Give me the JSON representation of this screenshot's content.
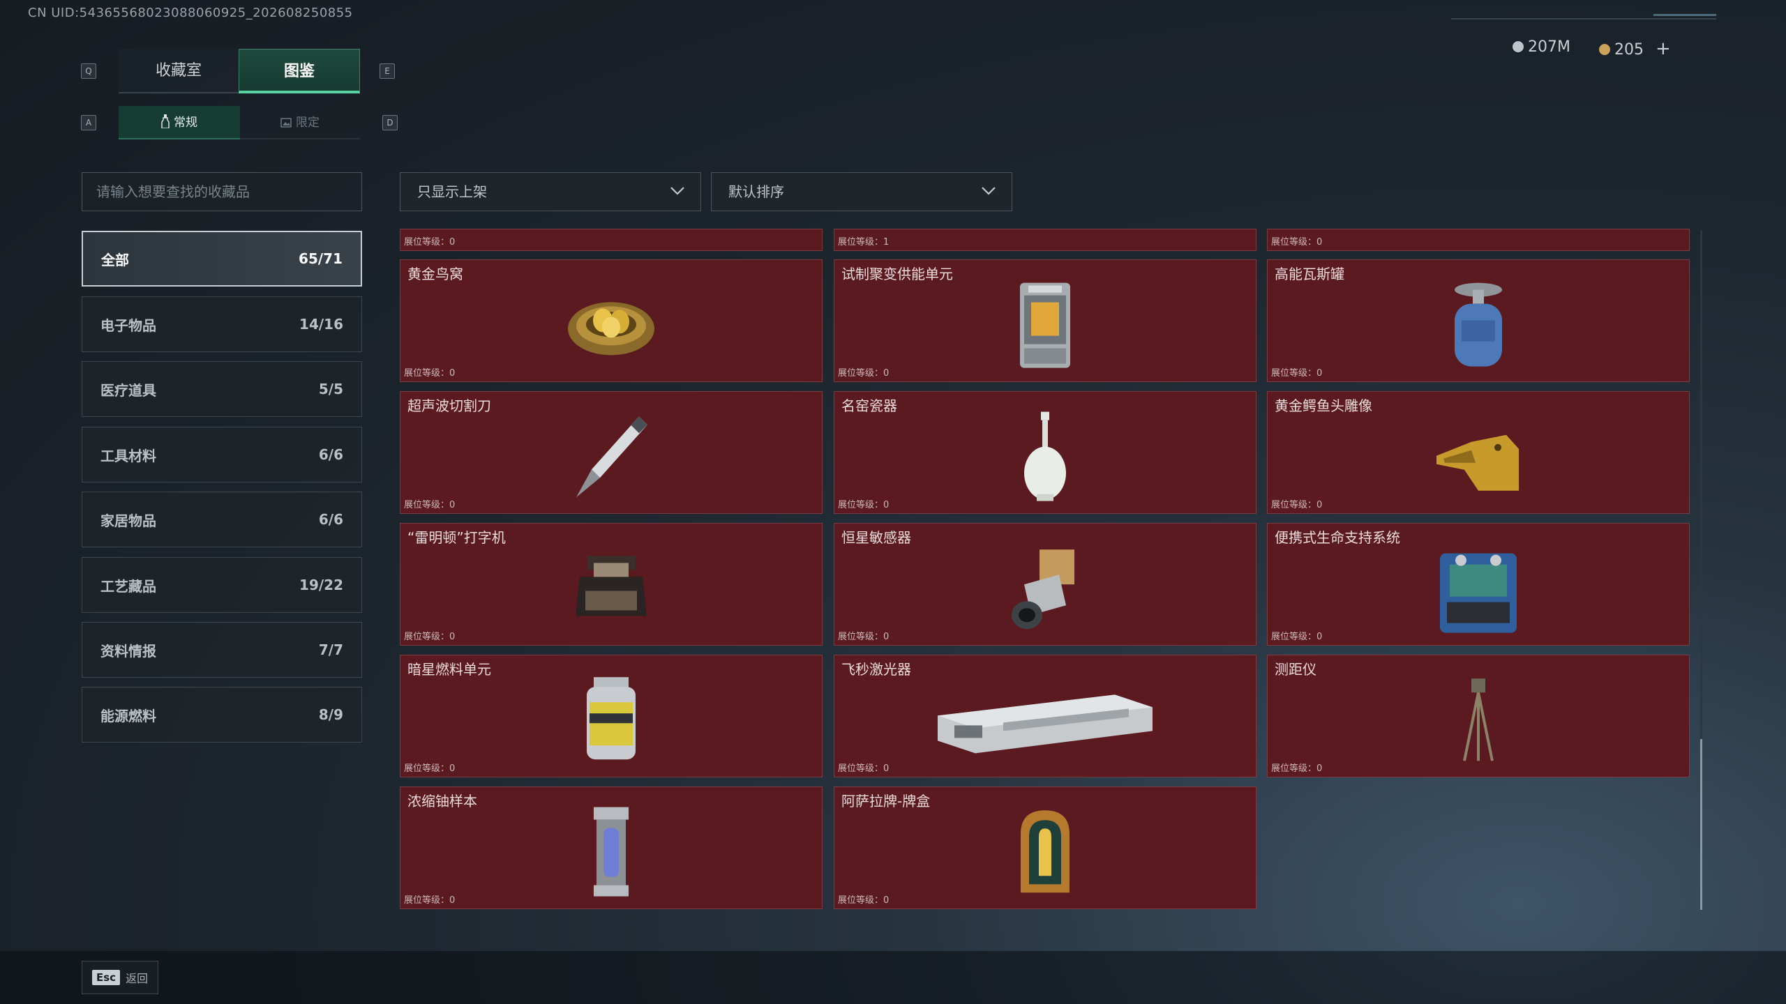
{
  "uid": "CN UID:5436556802308806092​5_202608250855",
  "keys": {
    "prev_tab": "Q",
    "next_tab": "E",
    "prev_sub": "A",
    "next_sub": "D"
  },
  "tabs": [
    {
      "label": "收藏室",
      "active": false
    },
    {
      "label": "图鉴",
      "active": true
    }
  ],
  "sub_tabs": [
    {
      "label": "常规",
      "icon": "bottle-icon",
      "active": true
    },
    {
      "label": "限定",
      "icon": "image-icon",
      "active": false
    }
  ],
  "currency": {
    "silver": {
      "value": "207M",
      "color": "#bfc5ca"
    },
    "gold": {
      "value": "205",
      "color": "#c9a35a",
      "add": "+"
    }
  },
  "search": {
    "placeholder": "请输入想要查找的收藏品"
  },
  "filters": {
    "shelf": {
      "value": "只显示上架"
    },
    "sort": {
      "value": "默认排序"
    }
  },
  "categories": [
    {
      "label": "全部",
      "count": "65/71",
      "active": true
    },
    {
      "label": "电子物品",
      "count": "14/16"
    },
    {
      "label": "医疗道具",
      "count": "5/5"
    },
    {
      "label": "工具材料",
      "count": "6/6"
    },
    {
      "label": "家居物品",
      "count": "6/6"
    },
    {
      "label": "工艺藏品",
      "count": "19/22"
    },
    {
      "label": "资料情报",
      "count": "7/7"
    },
    {
      "label": "能源燃料",
      "count": "8/9"
    }
  ],
  "partial_row": [
    {
      "level": "展位等级：0"
    },
    {
      "level": "展位等级：1"
    },
    {
      "level": "展位等级：0"
    }
  ],
  "items": [
    {
      "name": "黄金鸟窝",
      "level": "展位等级：0",
      "icon": "golden-nest-icon"
    },
    {
      "name": "试制聚变供能单元",
      "level": "展位等级：0",
      "icon": "fusion-unit-icon"
    },
    {
      "name": "高能瓦斯罐",
      "level": "展位等级：0",
      "icon": "gas-canister-icon"
    },
    {
      "name": "超声波切割刀",
      "level": "展位等级：0",
      "icon": "ultrasonic-knife-icon"
    },
    {
      "name": "名窑瓷器",
      "level": "展位等级：0",
      "icon": "porcelain-vase-icon"
    },
    {
      "name": "黄金鳄鱼头雕像",
      "level": "展位等级：0",
      "icon": "golden-croc-statue-icon"
    },
    {
      "name": "“雷明顿”打字机",
      "level": "展位等级：0",
      "icon": "typewriter-icon"
    },
    {
      "name": "恒星敏感器",
      "level": "展位等级：0",
      "icon": "star-sensor-icon"
    },
    {
      "name": "便携式生命支持系统",
      "level": "展位等级：0",
      "icon": "life-support-icon"
    },
    {
      "name": "暗星燃料单元",
      "level": "展位等级：0",
      "icon": "fuel-cell-icon"
    },
    {
      "name": "飞秒激光器",
      "level": "展位等级：0",
      "icon": "femto-laser-icon"
    },
    {
      "name": "测距仪",
      "level": "展位等级：0",
      "icon": "rangefinder-icon"
    },
    {
      "name": "浓缩铀样本",
      "level": "展位等级：0",
      "icon": "uranium-sample-icon"
    },
    {
      "name": "阿萨拉牌-牌盒",
      "level": "展位等级：0",
      "icon": "card-box-icon"
    }
  ],
  "footer": {
    "esc_key": "Esc",
    "back_label": "返回"
  }
}
